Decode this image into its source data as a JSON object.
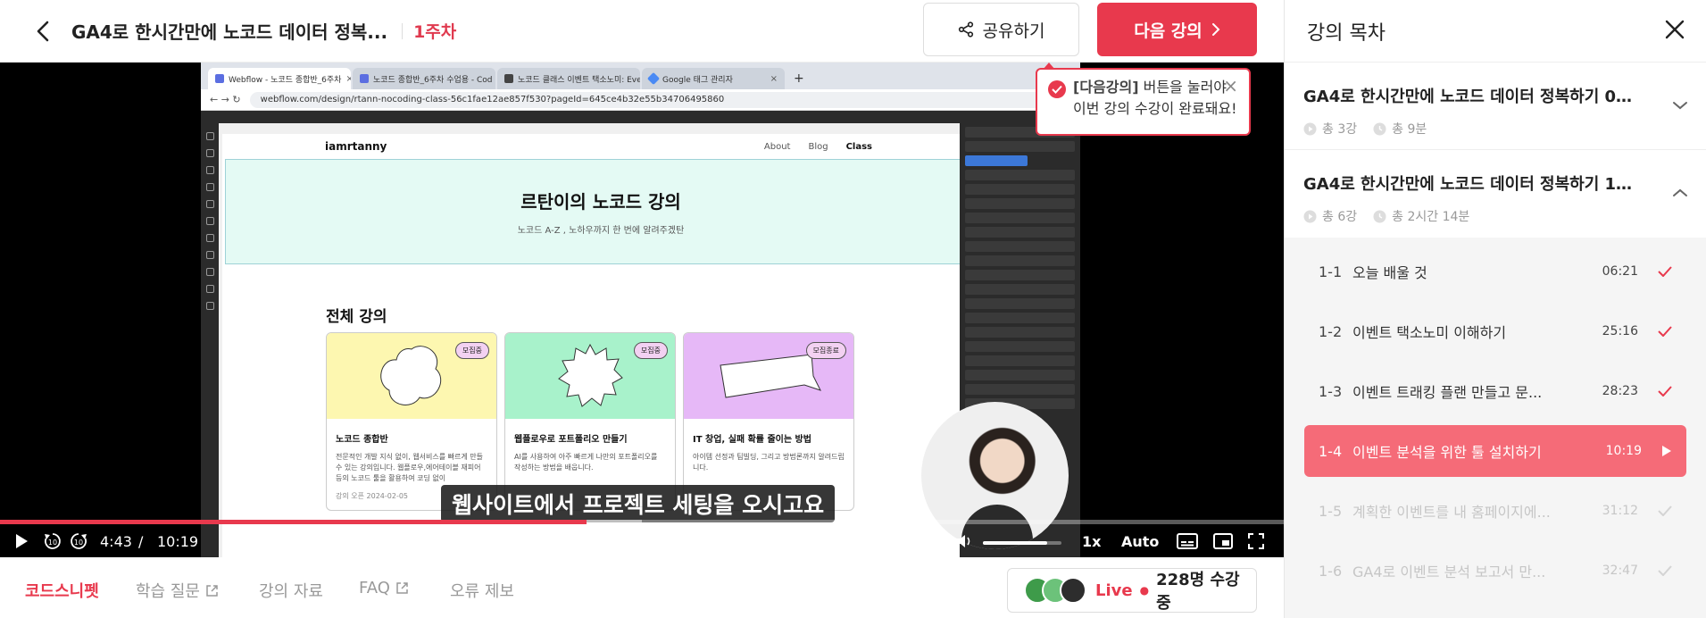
{
  "header": {
    "course_title": "GA4로 한시간만에 노코드 데이터 정복...",
    "week": "1주차",
    "share_label": "공유하기",
    "next_label": "다음 강의"
  },
  "callout": {
    "highlight": "[다음강의]",
    "line1_rest": " 버튼을 눌러야",
    "line2": "이번 강의 수강이 완료돼요!"
  },
  "player": {
    "current_time": "4:43",
    "time_separator": "/",
    "duration": "10:19",
    "progress_fraction": 0.457,
    "volume_fraction": 0.82,
    "subtitle": "웹사이트에서 프로젝트 세팅을 오시고요",
    "speed": "1x",
    "quality": "Auto"
  },
  "screen": {
    "tabs": [
      "Webflow - 노코드 종합반_6주차",
      "노코드 종합반_6주차 수업용 - Cod",
      "노코드 클래스 이벤트 택소노미: Eve",
      "Google 태그 관리자"
    ],
    "url": "webflow.com/design/rtann-nocoding-class-56c1fae12ae857f530?pageId=645ce4b32e55b34706495860",
    "site_logo": "iamrtanny",
    "site_links": [
      "About",
      "Blog",
      "Class"
    ],
    "hero_title": "르탄이의 노코드 강의",
    "hero_sub": "노코드 A-Z , 노하우까지 한 번에 알려주겠탄",
    "section_title": "전체 강의",
    "cards": [
      {
        "badge": "모집중",
        "title": "노코드 종합반",
        "desc": "전문적인 개발 지식 없이, 웹서비스를 빠르게 만들 수 있는 강의입니다. 웹플로우,에어테이블 재피어 등의 노코드 툴을 활용하여 코딩 없이",
        "date": "강의 오픈 2024-02-05",
        "color": "#fdf7b0"
      },
      {
        "badge": "모집중",
        "title": "웹플로우로 포트폴리오 만들기",
        "desc": "AI를 사용하여 아주 빠르게 나만의 포트폴리오를 작성하는 방법을 배웁니다.",
        "date": "",
        "color": "#a8f2cb"
      },
      {
        "badge": "모집종료",
        "title": "IT 창업, 실패 확률 줄이는 방법",
        "desc": "아이템 선정과 팀빌딩, 그리고 방법론까지 알려드립니다.",
        "date": "",
        "color": "#e6b8f7"
      }
    ]
  },
  "bottom": {
    "tabs": [
      {
        "label": "코드스니펫",
        "external": false
      },
      {
        "label": "학습 질문",
        "external": true
      },
      {
        "label": "강의 자료",
        "external": false
      },
      {
        "label": "FAQ",
        "external": true
      },
      {
        "label": "오류 제보",
        "external": false
      }
    ],
    "live_label": "Live",
    "viewers": "228명 수강 중"
  },
  "panel": {
    "title": "강의 목차",
    "chapters": [
      {
        "title": "GA4로 한시간만에 노코드 데이터 정복하기 0...",
        "count": "총 3강",
        "time": "총 9분",
        "expanded": false
      },
      {
        "title": "GA4로 한시간만에 노코드 데이터 정복하기 1...",
        "count": "총 6강",
        "time": "총 2시간 14분",
        "expanded": true
      }
    ],
    "lessons": [
      {
        "num": "1-1",
        "name": "오늘 배울 것",
        "dur": "06:21",
        "state": "done"
      },
      {
        "num": "1-2",
        "name": "이벤트 택소노미 이해하기",
        "dur": "25:16",
        "state": "done"
      },
      {
        "num": "1-3",
        "name": "이벤트 트래킹 플랜 만들고 문...",
        "dur": "28:23",
        "state": "done"
      },
      {
        "num": "1-4",
        "name": "이벤트 분석을 위한 툴 설치하기",
        "dur": "10:19",
        "state": "current"
      },
      {
        "num": "1-5",
        "name": "계획한 이벤트를 내 홈페이지에...",
        "dur": "31:12",
        "state": "locked"
      },
      {
        "num": "1-6",
        "name": "GA4로 이벤트 분석 보고서 만...",
        "dur": "32:47",
        "state": "locked"
      }
    ]
  },
  "colors": {
    "accent": "#e8394d",
    "current_lesson": "#f56b78",
    "check": "#e8394d"
  }
}
